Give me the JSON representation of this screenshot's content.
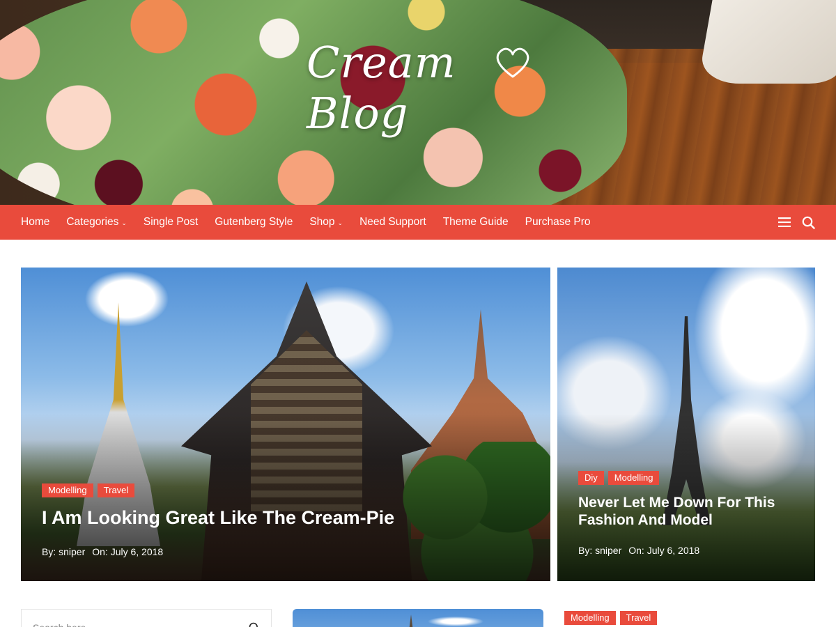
{
  "site": {
    "logo_text": "Cream Blog"
  },
  "nav": {
    "items": [
      {
        "label": "Home",
        "has_dropdown": false
      },
      {
        "label": "Categories",
        "has_dropdown": true
      },
      {
        "label": "Single Post",
        "has_dropdown": false
      },
      {
        "label": "Gutenberg Style",
        "has_dropdown": false
      },
      {
        "label": "Shop",
        "has_dropdown": true
      },
      {
        "label": "Need Support",
        "has_dropdown": false
      },
      {
        "label": "Theme Guide",
        "has_dropdown": false
      },
      {
        "label": "Purchase Pro",
        "has_dropdown": false
      }
    ],
    "icons": [
      "menu-icon",
      "search-icon"
    ]
  },
  "featured": [
    {
      "tags": [
        "Modelling",
        "Travel"
      ],
      "title": "I Am Looking Great Like The Cream-Pie",
      "author": "By: sniper",
      "date": "On: July 6, 2018"
    },
    {
      "tags": [
        "Diy",
        "Modelling"
      ],
      "title": "Never Let Me Down For This Fashion And Model",
      "author": "By: sniper",
      "date": "On: July 6, 2018"
    }
  ],
  "sidebar": {
    "search_placeholder": "Search here"
  },
  "lower_post": {
    "tags": [
      "Modelling",
      "Travel"
    ]
  },
  "colors": {
    "accent": "#e94b3c",
    "text_on_accent": "#ffffff"
  }
}
